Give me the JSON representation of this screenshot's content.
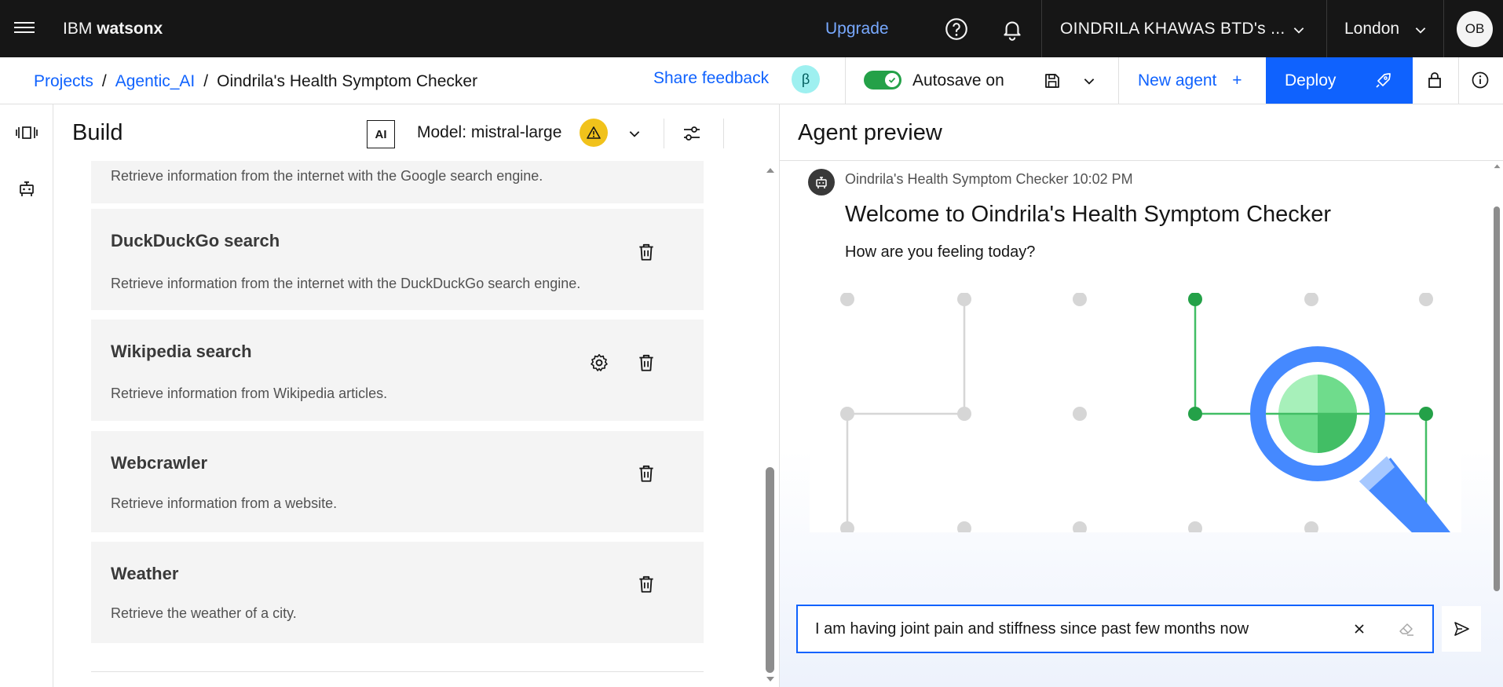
{
  "topbar": {
    "brand_light": "IBM",
    "brand_bold": "watsonx",
    "upgrade": "Upgrade",
    "account": "OINDRILA KHAWAS BTD's ...",
    "region": "London",
    "avatar_initials": "OB"
  },
  "subbar": {
    "breadcrumbs": [
      "Projects",
      "Agentic_AI",
      "Oindrila's Health Symptom Checker"
    ],
    "share_feedback": "Share feedback",
    "beta": "β",
    "autosave_label": "Autosave on",
    "autosave_on": true,
    "new_agent": "New agent",
    "new_agent_plus": "+",
    "deploy": "Deploy"
  },
  "build": {
    "title": "Build",
    "ai_badge": "AI",
    "model_label": "Model: mistral-large",
    "tools": [
      {
        "name": "",
        "description": "Retrieve information from the internet with the Google search engine."
      },
      {
        "name": "DuckDuckGo search",
        "description": "Retrieve information from the internet with the DuckDuckGo search engine."
      },
      {
        "name": "Wikipedia search",
        "description": "Retrieve information from Wikipedia articles.",
        "has_settings": true
      },
      {
        "name": "Webcrawler",
        "description": "Retrieve information from a website."
      },
      {
        "name": "Weather",
        "description": "Retrieve the weather of a city."
      }
    ]
  },
  "preview": {
    "title": "Agent preview",
    "agent_name": "Oindrila's Health Symptom Checker",
    "time": "10:02 PM",
    "welcome": "Welcome to Oindrila's Health Symptom Checker",
    "question": "How are you feeling today?",
    "input_value": "I am having joint pain and stiffness since past few months now"
  },
  "colors": {
    "accent": "#0f62fe",
    "topbar_bg": "#161616",
    "toggle_on": "#24a148",
    "warning": "#f1c21b",
    "illus_green": "#42be65",
    "illus_blue": "#4589ff"
  },
  "icons": [
    "hamburger-icon",
    "help-icon",
    "notification-icon",
    "chevron-down-icon",
    "save-icon",
    "rocket-icon",
    "lock-icon",
    "info-icon",
    "filmstrip-icon",
    "agent-icon",
    "warning-icon",
    "settings-sliders-icon",
    "chevron-left-icon",
    "trash-icon",
    "gear-icon",
    "bot-icon",
    "close-icon",
    "eraser-icon",
    "send-icon"
  ]
}
